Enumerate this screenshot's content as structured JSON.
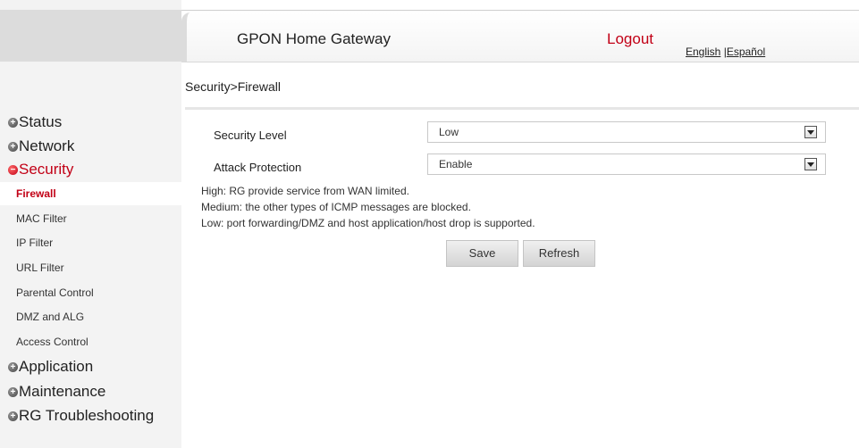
{
  "header": {
    "title": "GPON Home Gateway",
    "logout": "Logout",
    "lang_english": "English",
    "lang_sep": " |",
    "lang_spanish": "Español"
  },
  "breadcrumb": "Security>Firewall",
  "sidebar": {
    "status": "Status",
    "network": "Network",
    "security": "Security",
    "security_items": [
      "Firewall",
      "MAC Filter",
      "IP Filter",
      "URL Filter",
      "Parental Control",
      "DMZ and ALG",
      "Access Control"
    ],
    "application": "Application",
    "maintenance": "Maintenance",
    "rg_troubleshooting": "RG Troubleshooting"
  },
  "form": {
    "security_level_label": "Security Level",
    "security_level_value": "Low",
    "attack_protection_label": "Attack Protection",
    "attack_protection_value": "Enable"
  },
  "notes": [
    "High: RG provide service from WAN limited.",
    "Medium: the other types of ICMP messages are blocked.",
    "Low: port forwarding/DMZ and host application/host drop is supported."
  ],
  "buttons": {
    "save": "Save",
    "refresh": "Refresh"
  },
  "colors": {
    "accent": "#c20016",
    "sidebar_bg": "#f3f3f3",
    "button_bg": "#dcdcdc"
  }
}
